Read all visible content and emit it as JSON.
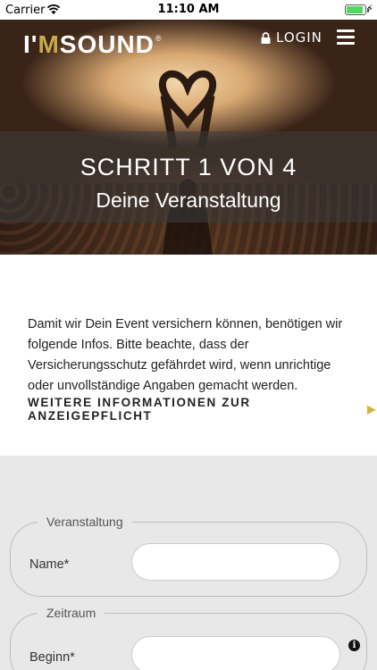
{
  "status": {
    "carrier": "Carrier",
    "time": "11:10 AM",
    "battery_level": 0.9
  },
  "header": {
    "logo": {
      "i": "I'",
      "m": "M",
      "rest": " SOUND",
      "reg": "®"
    },
    "login_label": "LOGIN"
  },
  "hero": {
    "step_title": "SCHRITT 1 VON 4",
    "step_subtitle": "Deine Veranstaltung"
  },
  "info": {
    "text": "Damit wir Dein Event versichern können, benötigen wir folgende Infos. Bitte beachte, dass der Versicherungsschutz gefährdet wird, wenn unrichtige oder unvollständige Angaben gemacht werden.",
    "more_link": "WEITERE INFORMATIONEN ZUR ANZEIGEPFLICHT"
  },
  "form": {
    "groups": [
      {
        "legend": "Veranstaltung",
        "field_label": "Name*",
        "value": ""
      },
      {
        "legend": "Zeitraum",
        "field_label": "Beginn*",
        "value": ""
      }
    ]
  },
  "icons": [
    "wifi-icon",
    "battery-icon",
    "lock-icon",
    "menu-icon",
    "chevron-right-icon",
    "info-icon"
  ],
  "colors": {
    "accent": "#d4b43c",
    "form_bg": "#e8e8e8",
    "battery": "#4cd964"
  }
}
